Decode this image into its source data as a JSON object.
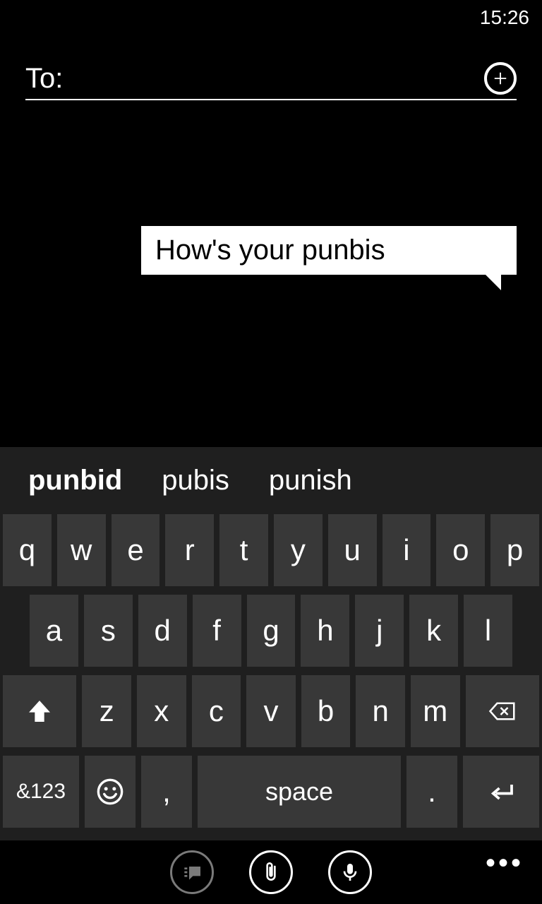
{
  "status": {
    "time": "15:26"
  },
  "to": {
    "label": "To:",
    "value": ""
  },
  "compose": {
    "text": "How's your punbis"
  },
  "suggestions": {
    "selected": "punbid",
    "alt1": "pubis",
    "alt2": "punish"
  },
  "keys": {
    "row1": [
      "q",
      "w",
      "e",
      "r",
      "t",
      "y",
      "u",
      "i",
      "o",
      "p"
    ],
    "row2": [
      "a",
      "s",
      "d",
      "f",
      "g",
      "h",
      "j",
      "k",
      "l"
    ],
    "row3": [
      "z",
      "x",
      "c",
      "v",
      "b",
      "n",
      "m"
    ],
    "symbols": "&123",
    "comma": ",",
    "space": "space",
    "period": "."
  }
}
